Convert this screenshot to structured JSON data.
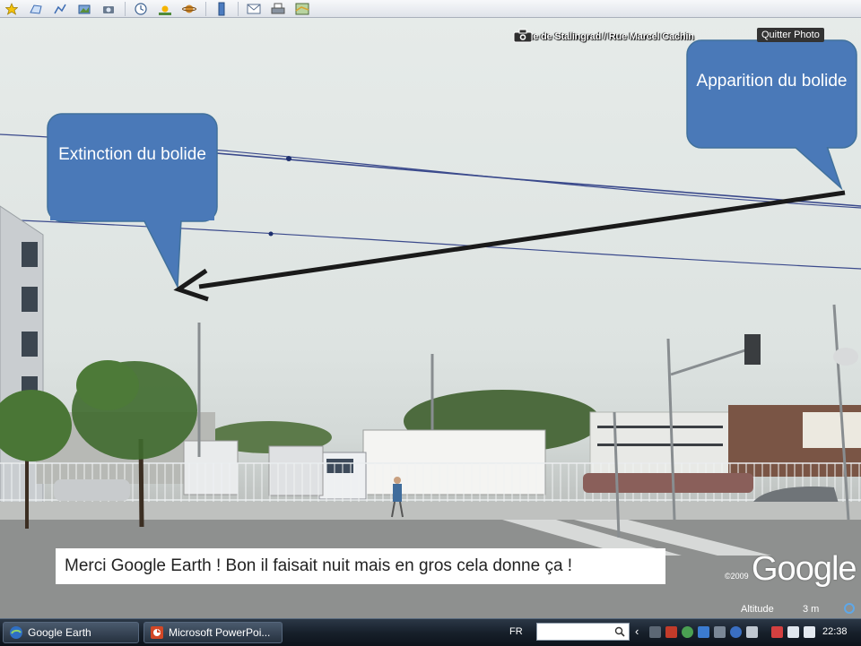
{
  "toolbar": {
    "buttons": [
      "placemark",
      "polygon",
      "path",
      "overlay",
      "record-tour",
      "historical-imagery",
      "sunlight",
      "planets",
      "ruler",
      "email",
      "print",
      "view-in-maps"
    ]
  },
  "photo": {
    "location": "Rue de Stalingrad / Rue Marcel Cachin",
    "quit_label": "Quitter Photo"
  },
  "callouts": {
    "appearance": "Apparition du bolide",
    "extinction": "Extinction du bolide",
    "color": "#4a79b8"
  },
  "caption": "Merci Google Earth ! Bon il faisait nuit mais en gros cela donne  ça !",
  "overlay": {
    "copyright": "©2009",
    "brand": "Google",
    "altitude_label": "Altitude",
    "altitude_value": "3 m"
  },
  "taskbar": {
    "apps": [
      {
        "label": "Google Earth",
        "icon": "google-earth-icon"
      },
      {
        "label": "Microsoft PowerPoi...",
        "icon": "powerpoint-icon"
      }
    ],
    "language": "FR",
    "time": "22:38"
  }
}
